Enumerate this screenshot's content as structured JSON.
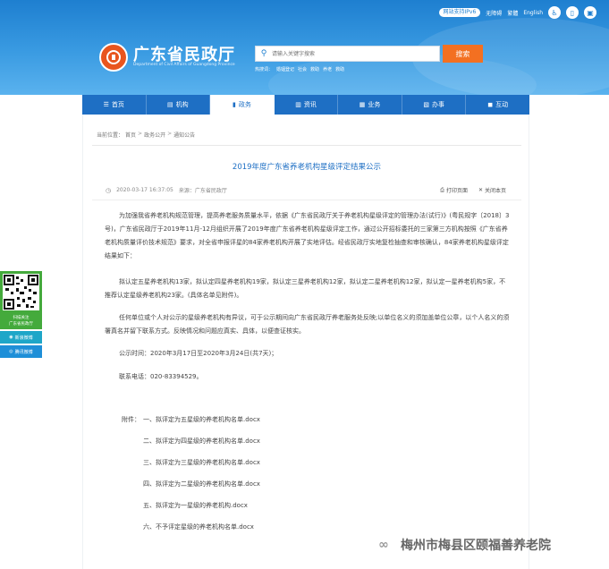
{
  "header": {
    "site_title": "广东省民政厅",
    "site_subtitle": "Department of Civil Affairs of Guangdong Province",
    "top_links": {
      "ipv6": "网站支持IPv6",
      "accessibility": "无障碍",
      "traditional": "繁體",
      "english": "English"
    },
    "search": {
      "placeholder": "请输入关键字搜索",
      "button": "搜索",
      "hot_label": "热搜词：",
      "hot_terms": [
        "婚姻登记",
        "社会",
        "救助",
        "养老",
        "救助"
      ]
    }
  },
  "nav": {
    "items": [
      {
        "label": "首页",
        "icon": "home-icon"
      },
      {
        "label": "机构",
        "icon": "building-icon"
      },
      {
        "label": "政务",
        "icon": "book-icon",
        "active": true
      },
      {
        "label": "资讯",
        "icon": "news-icon"
      },
      {
        "label": "业务",
        "icon": "chart-icon"
      },
      {
        "label": "办事",
        "icon": "task-icon"
      },
      {
        "label": "互动",
        "icon": "chat-icon"
      }
    ]
  },
  "breadcrumb": {
    "prefix": "当前位置：",
    "items": [
      "首页",
      "政务公开",
      "通知公告"
    ]
  },
  "article": {
    "title": "2019年度广东省养老机构星级评定结果公示",
    "datetime": "2020-03-17 16:37:05",
    "source": "来源：广东省民政厅",
    "print": "打印页面",
    "close": "关闭本页",
    "paragraphs": [
      "为加强我省养老机构规范管理，提高养老服务质量水平，依据《广东省民政厅关于养老机构星级评定的管理办法(试行)》(粤民规字〔2018〕3号)，广东省民政厅于2019年11月-12月组织开展了2019年度广东省养老机构星级评定工作，通过公开招标委托的三家第三方机构按照《广东省养老机构质量评价技术规范》要求，对全省申报评星的84家养老机构开展了实地评估。经省民政厅实地复检抽查和审核确认，84家养老机构星级评定结果如下：",
      "拟认定五星养老机构13家，拟认定四星养老机构19家，拟认定三星养老机构12家，拟认定二星养老机构12家，拟认定一星养老机构5家，不推荐认定星级养老机构23家。(具体名单见附件)。",
      "任何单位或个人对公示的星级养老机构有异议，可于公示期间向广东省民政厅养老服务处反映;以单位名义的须加盖单位公章，以个人名义的须署真名并留下联系方式。反映情况和问题应真实、具体，以便查证核实。"
    ],
    "period": "公示时间：2020年3月17日至2020年3月24日(共7天)；",
    "phone": "联系电话：020-83394529。",
    "attachments_label": "附件：",
    "attachments": [
      "一、拟评定为五星级的养老机构名单.docx",
      "二、拟评定为四星级的养老机构名单.docx",
      "三、拟评定为三星级的养老机构名单.docx",
      "四、拟评定为二星级的养老机构名单.docx",
      "五、拟评定为一星级的养老机构.docx",
      "六、不予评定星级的养老机构名单.docx"
    ]
  },
  "side": {
    "qr_caption_1": "扫描关注",
    "qr_caption_2": "广东省民政厅",
    "weibo": "新浪微博",
    "toutiao": "腾讯微博"
  },
  "watermark": {
    "text": "梅州市梅县区颐福善养老院"
  },
  "colors": {
    "header_blue": "#1e7fd0",
    "nav_blue": "#1e6fc4",
    "search_orange": "#f37021",
    "qr_green": "#44aa3c"
  }
}
